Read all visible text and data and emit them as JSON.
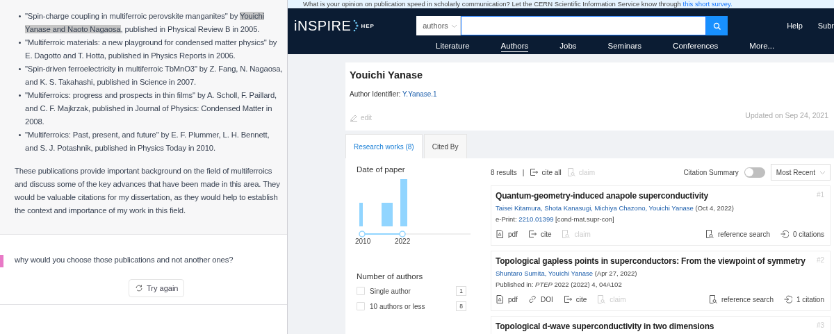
{
  "chat": {
    "bullets": [
      {
        "segments": [
          {
            "text": "\"Spin-charge coupling in multiferroic perovskite manganites\" by ",
            "highlighted": false
          },
          {
            "text": "Youichi Yanase and Naoto Nagaosa",
            "highlighted": true
          },
          {
            "text": ", published in Physical Review B in 2005.",
            "highlighted": false
          }
        ]
      },
      {
        "segments": [
          {
            "text": "\"Multiferroic materials: a new playground for condensed matter physics\" by E. Dagotto and T. Hotta, published in Physics Reports in 2006.",
            "highlighted": false
          }
        ]
      },
      {
        "segments": [
          {
            "text": "\"Spin-driven ferroelectricity in multiferroic TbMnO3\" by Z. Fang, N. Nagaosa, and K. S. Takahashi, published in Science in 2007.",
            "highlighted": false
          }
        ]
      },
      {
        "segments": [
          {
            "text": "\"Multiferroics: progress and prospects in thin films\" by A. Scholl, F. Paillard, and C. F. Majkrzak, published in Journal of Physics: Condensed Matter in 2008.",
            "highlighted": false
          }
        ]
      },
      {
        "segments": [
          {
            "text": "\"Multiferroics: Past, present, and future\" by E. F. Plummer, L. H. Bennett, and S. J. Potashnik, published in Physics Today in 2010.",
            "highlighted": false
          }
        ]
      }
    ],
    "paragraph": "These publications provide important background on the field of multiferroics and discuss some of the key advances that have been made in this area. They would be valuable citations for my dissertation, as they would help to establish the context and importance of my work in this field.",
    "prompt": "why would you choose those publications and not another ones?",
    "try_again": "Try again"
  },
  "inspire": {
    "banner": {
      "text": "What is your opinion on publication speed in scholarly communication? Let the CERN Scientific Information Service know through ",
      "link": "this short survey."
    },
    "logo": {
      "main": "iNSPIRE",
      "sub": "HEP"
    },
    "search": {
      "scope": "authors"
    },
    "header_links": [
      "Help",
      "Subr"
    ],
    "nav": [
      {
        "label": "Literature",
        "selected": false
      },
      {
        "label": "Authors",
        "selected": true
      },
      {
        "label": "Jobs",
        "selected": false
      },
      {
        "label": "Seminars",
        "selected": false
      },
      {
        "label": "Conferences",
        "selected": false
      },
      {
        "label": "More...",
        "selected": false
      }
    ],
    "author": {
      "name": "Youichi Yanase",
      "identifier_label": "Author Identifier:",
      "identifier": "Y.Yanase.1",
      "edit": "edit",
      "updated": "Updated on Sep 24, 2021"
    },
    "tabs": [
      {
        "label": "Research works (8)",
        "selected": true
      },
      {
        "label": "Cited By",
        "selected": false
      }
    ],
    "facets": {
      "date_title": "Date of paper",
      "range_start": "2010",
      "range_end": "2022",
      "authors_title": "Number of authors",
      "options": [
        {
          "label": "Single author",
          "count": "1",
          "checked": false
        },
        {
          "label": "10 authors or less",
          "count": "8",
          "checked": false
        }
      ]
    },
    "results": {
      "count": "8 results",
      "separator": "|",
      "cite_all": "cite all",
      "claim": "claim",
      "citation_summary": {
        "label": "Citation Summary",
        "on": false
      },
      "sort": "Most Recent",
      "records": [
        {
          "title": "Quantum-geometry-induced anapole superconductivity",
          "number": "#1",
          "authors": "Taisei Kitamura, Shota Kanasugi, Michiya Chazono, Youichi Yanase",
          "date": "(Oct 4, 2022)",
          "info": {
            "kind": "eprint",
            "label": "e-Print:",
            "link": "2210.01399",
            "after": "[cond-mat.supr-con]"
          },
          "actions": [
            {
              "kind": "pdf",
              "label": "pdf",
              "disabled": false
            },
            {
              "kind": "cite",
              "label": "cite",
              "disabled": false
            },
            {
              "kind": "claim",
              "label": "claim",
              "disabled": true
            }
          ],
          "reference": "reference search",
          "citations": "0 citations"
        },
        {
          "title": "Topological gapless points in superconductors: From the viewpoint of symmetry",
          "number": "#2",
          "authors": "Shuntaro Sumita, Youichi Yanase",
          "date": "(Apr 27, 2022)",
          "info": {
            "kind": "published",
            "label": "Published in:",
            "journal": "PTEP",
            "after": "2022 (2022) 4, 04A102"
          },
          "actions": [
            {
              "kind": "pdf",
              "label": "pdf",
              "disabled": false
            },
            {
              "kind": "doi",
              "label": "DOI",
              "disabled": false
            },
            {
              "kind": "cite",
              "label": "cite",
              "disabled": false
            },
            {
              "kind": "claim",
              "label": "claim",
              "disabled": true
            }
          ],
          "reference": "reference search",
          "citations": "1 citation"
        },
        {
          "title": "Topological d-wave superconductivity in two dimensions",
          "number": "#3"
        }
      ]
    }
  }
}
